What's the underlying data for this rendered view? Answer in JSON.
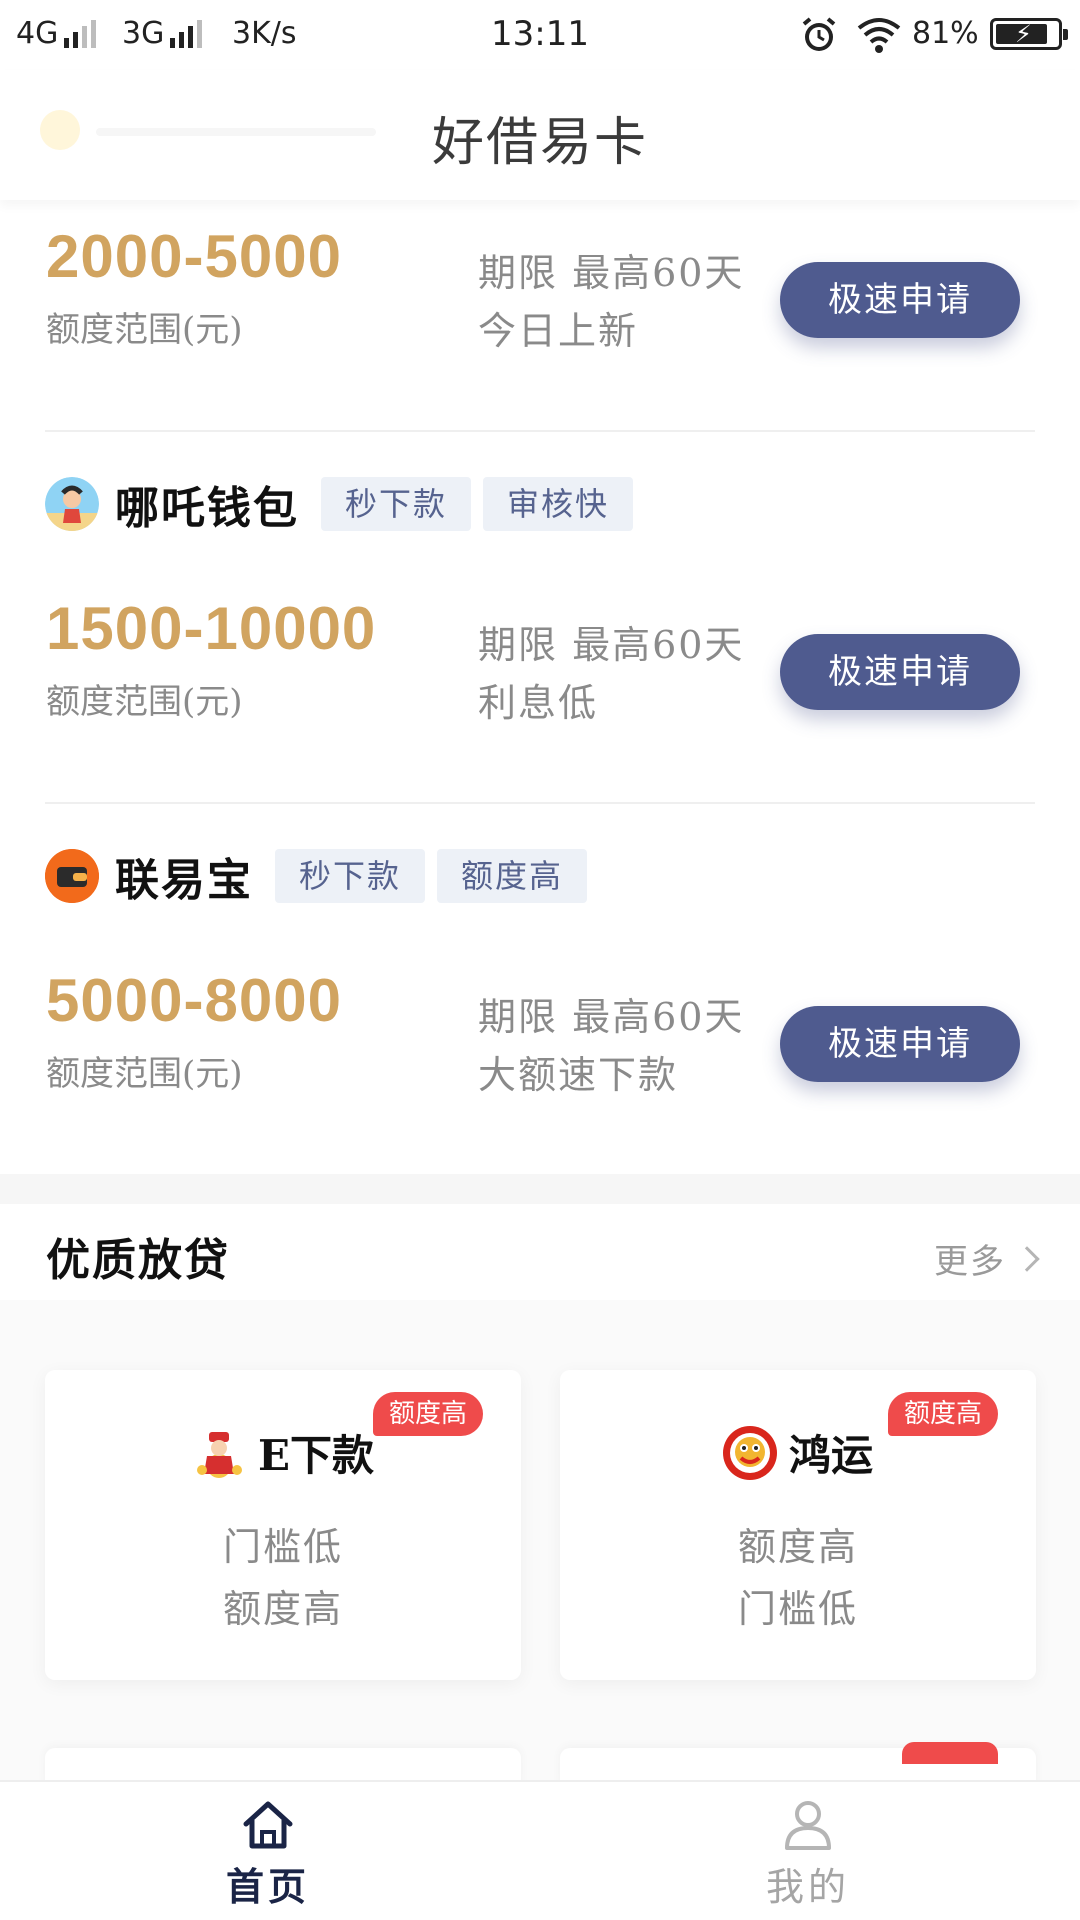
{
  "status_bar": {
    "network1": "4G",
    "network2": "3G",
    "speed": "3K/s",
    "time": "13:11",
    "battery": "81%",
    "battery_level": 0.81
  },
  "header": {
    "title": "好借易卡"
  },
  "loans": [
    {
      "amount": "2000-5000",
      "amount_label": "额度范围(元)",
      "term": "期限 最高60天",
      "note": "今日上新",
      "apply_label": "极速申请"
    },
    {
      "name": "哪吒钱包",
      "tags": [
        "秒下款",
        "审核快"
      ],
      "amount": "1500-10000",
      "amount_label": "额度范围(元)",
      "term": "期限 最高60天",
      "note": "利息低",
      "apply_label": "极速申请",
      "icon": "nezha-avatar-icon"
    },
    {
      "name": "联易宝",
      "tags": [
        "秒下款",
        "额度高"
      ],
      "amount": "5000-8000",
      "amount_label": "额度范围(元)",
      "term": "期限 最高60天",
      "note": "大额速下款",
      "apply_label": "极速申请",
      "icon": "wallet-icon"
    }
  ],
  "quality": {
    "title": "优质放贷",
    "more": "更多",
    "cards": [
      {
        "name": "E下款",
        "badge": "额度高",
        "lines": [
          "门槛低",
          "额度高"
        ],
        "icon": "fortune-god-icon"
      },
      {
        "name": "鸿运",
        "badge": "额度高",
        "lines": [
          "额度高",
          "门槛低"
        ],
        "icon": "lion-dance-icon"
      }
    ]
  },
  "tabbar": {
    "home": "首页",
    "mine": "我的"
  },
  "colors": {
    "amount": "#d1a460",
    "button": "#4f5b8f",
    "badge": "#ef4b4b",
    "tag_bg": "#edf1f7",
    "tag_text": "#56638f"
  }
}
